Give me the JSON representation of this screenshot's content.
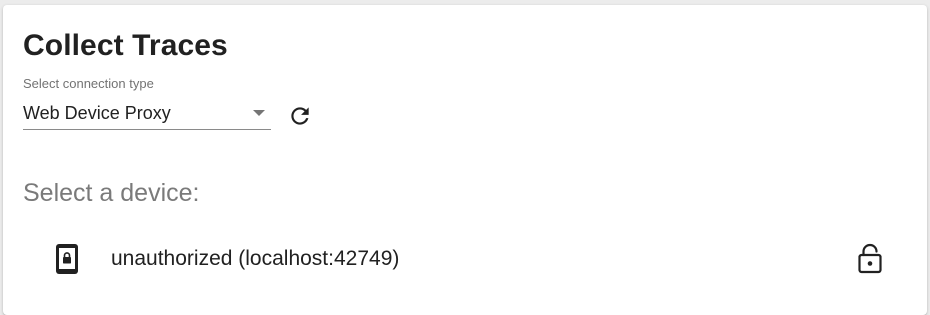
{
  "panel": {
    "title": "Collect Traces"
  },
  "connection": {
    "label": "Select connection type",
    "selected": "Web Device Proxy",
    "dropdown_icon": "arrow-drop-down-icon",
    "refresh_icon": "refresh-icon"
  },
  "devices": {
    "heading": "Select a device:",
    "items": [
      {
        "label": "unauthorized (localhost:42749)",
        "icon": "phone-lock-icon",
        "status_icon": "lock-open-icon"
      }
    ]
  },
  "colors": {
    "title_text": "#212121",
    "muted_text": "#7a7a7a",
    "icon": "#212121",
    "card_background": "#ffffff",
    "page_background": "#ececec"
  }
}
